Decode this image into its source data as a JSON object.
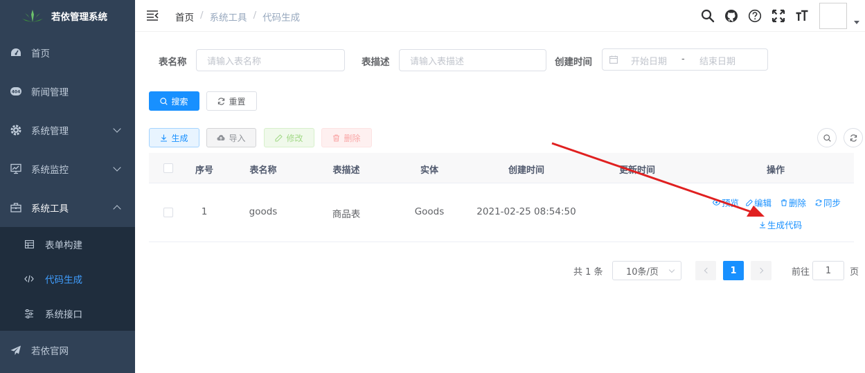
{
  "app": {
    "title": "若依管理系统"
  },
  "sidebar": {
    "items": [
      {
        "label": "首页",
        "icon": "dashboard-icon"
      },
      {
        "label": "新闻管理",
        "icon": "404-icon"
      },
      {
        "label": "系统管理",
        "icon": "system-gear-icon"
      },
      {
        "label": "系统监控",
        "icon": "monitor-icon"
      },
      {
        "label": "系统工具",
        "icon": "toolbox-icon"
      }
    ],
    "submenu": [
      {
        "label": "表单构建",
        "icon": "form-build-icon"
      },
      {
        "label": "代码生成",
        "icon": "code-icon",
        "active": true
      },
      {
        "label": "系统接口",
        "icon": "swagger-icon"
      }
    ],
    "bottom": {
      "label": "若依官网",
      "icon": "send-icon"
    }
  },
  "breadcrumb": [
    "首页",
    "系统工具",
    "代码生成"
  ],
  "search_form": {
    "table_name_label": "表名称",
    "table_name_placeholder": "请输入表名称",
    "table_desc_label": "表描述",
    "table_desc_placeholder": "请输入表描述",
    "created_label": "创建时间",
    "start_placeholder": "开始日期",
    "range_sep": "-",
    "end_placeholder": "结束日期",
    "search_btn": "搜索",
    "reset_btn": "重置"
  },
  "toolbar": {
    "generate": "生成",
    "import": "导入",
    "edit": "修改",
    "delete": "删除"
  },
  "table": {
    "columns": [
      "序号",
      "表名称",
      "表描述",
      "实体",
      "创建时间",
      "更新时间",
      "操作"
    ],
    "rows": [
      {
        "index": "1",
        "table_name": "goods",
        "table_desc": "商品表",
        "entity": "Goods",
        "created": "2021-02-25 08:54:50",
        "updated": "",
        "ops": {
          "preview": "预览",
          "edit": "编辑",
          "delete": "删除",
          "sync": "同步",
          "gen": "生成代码"
        }
      }
    ]
  },
  "pagination": {
    "total": "共 1 条",
    "page_size": "10条/页",
    "current": "1",
    "goto_label": "前往",
    "goto_value": "1",
    "page_suffix": "页"
  },
  "colors": {
    "primary": "#1890ff",
    "sidebar_bg": "#304156",
    "submenu_bg": "#1f2d3d",
    "arrow": "#e02020"
  }
}
